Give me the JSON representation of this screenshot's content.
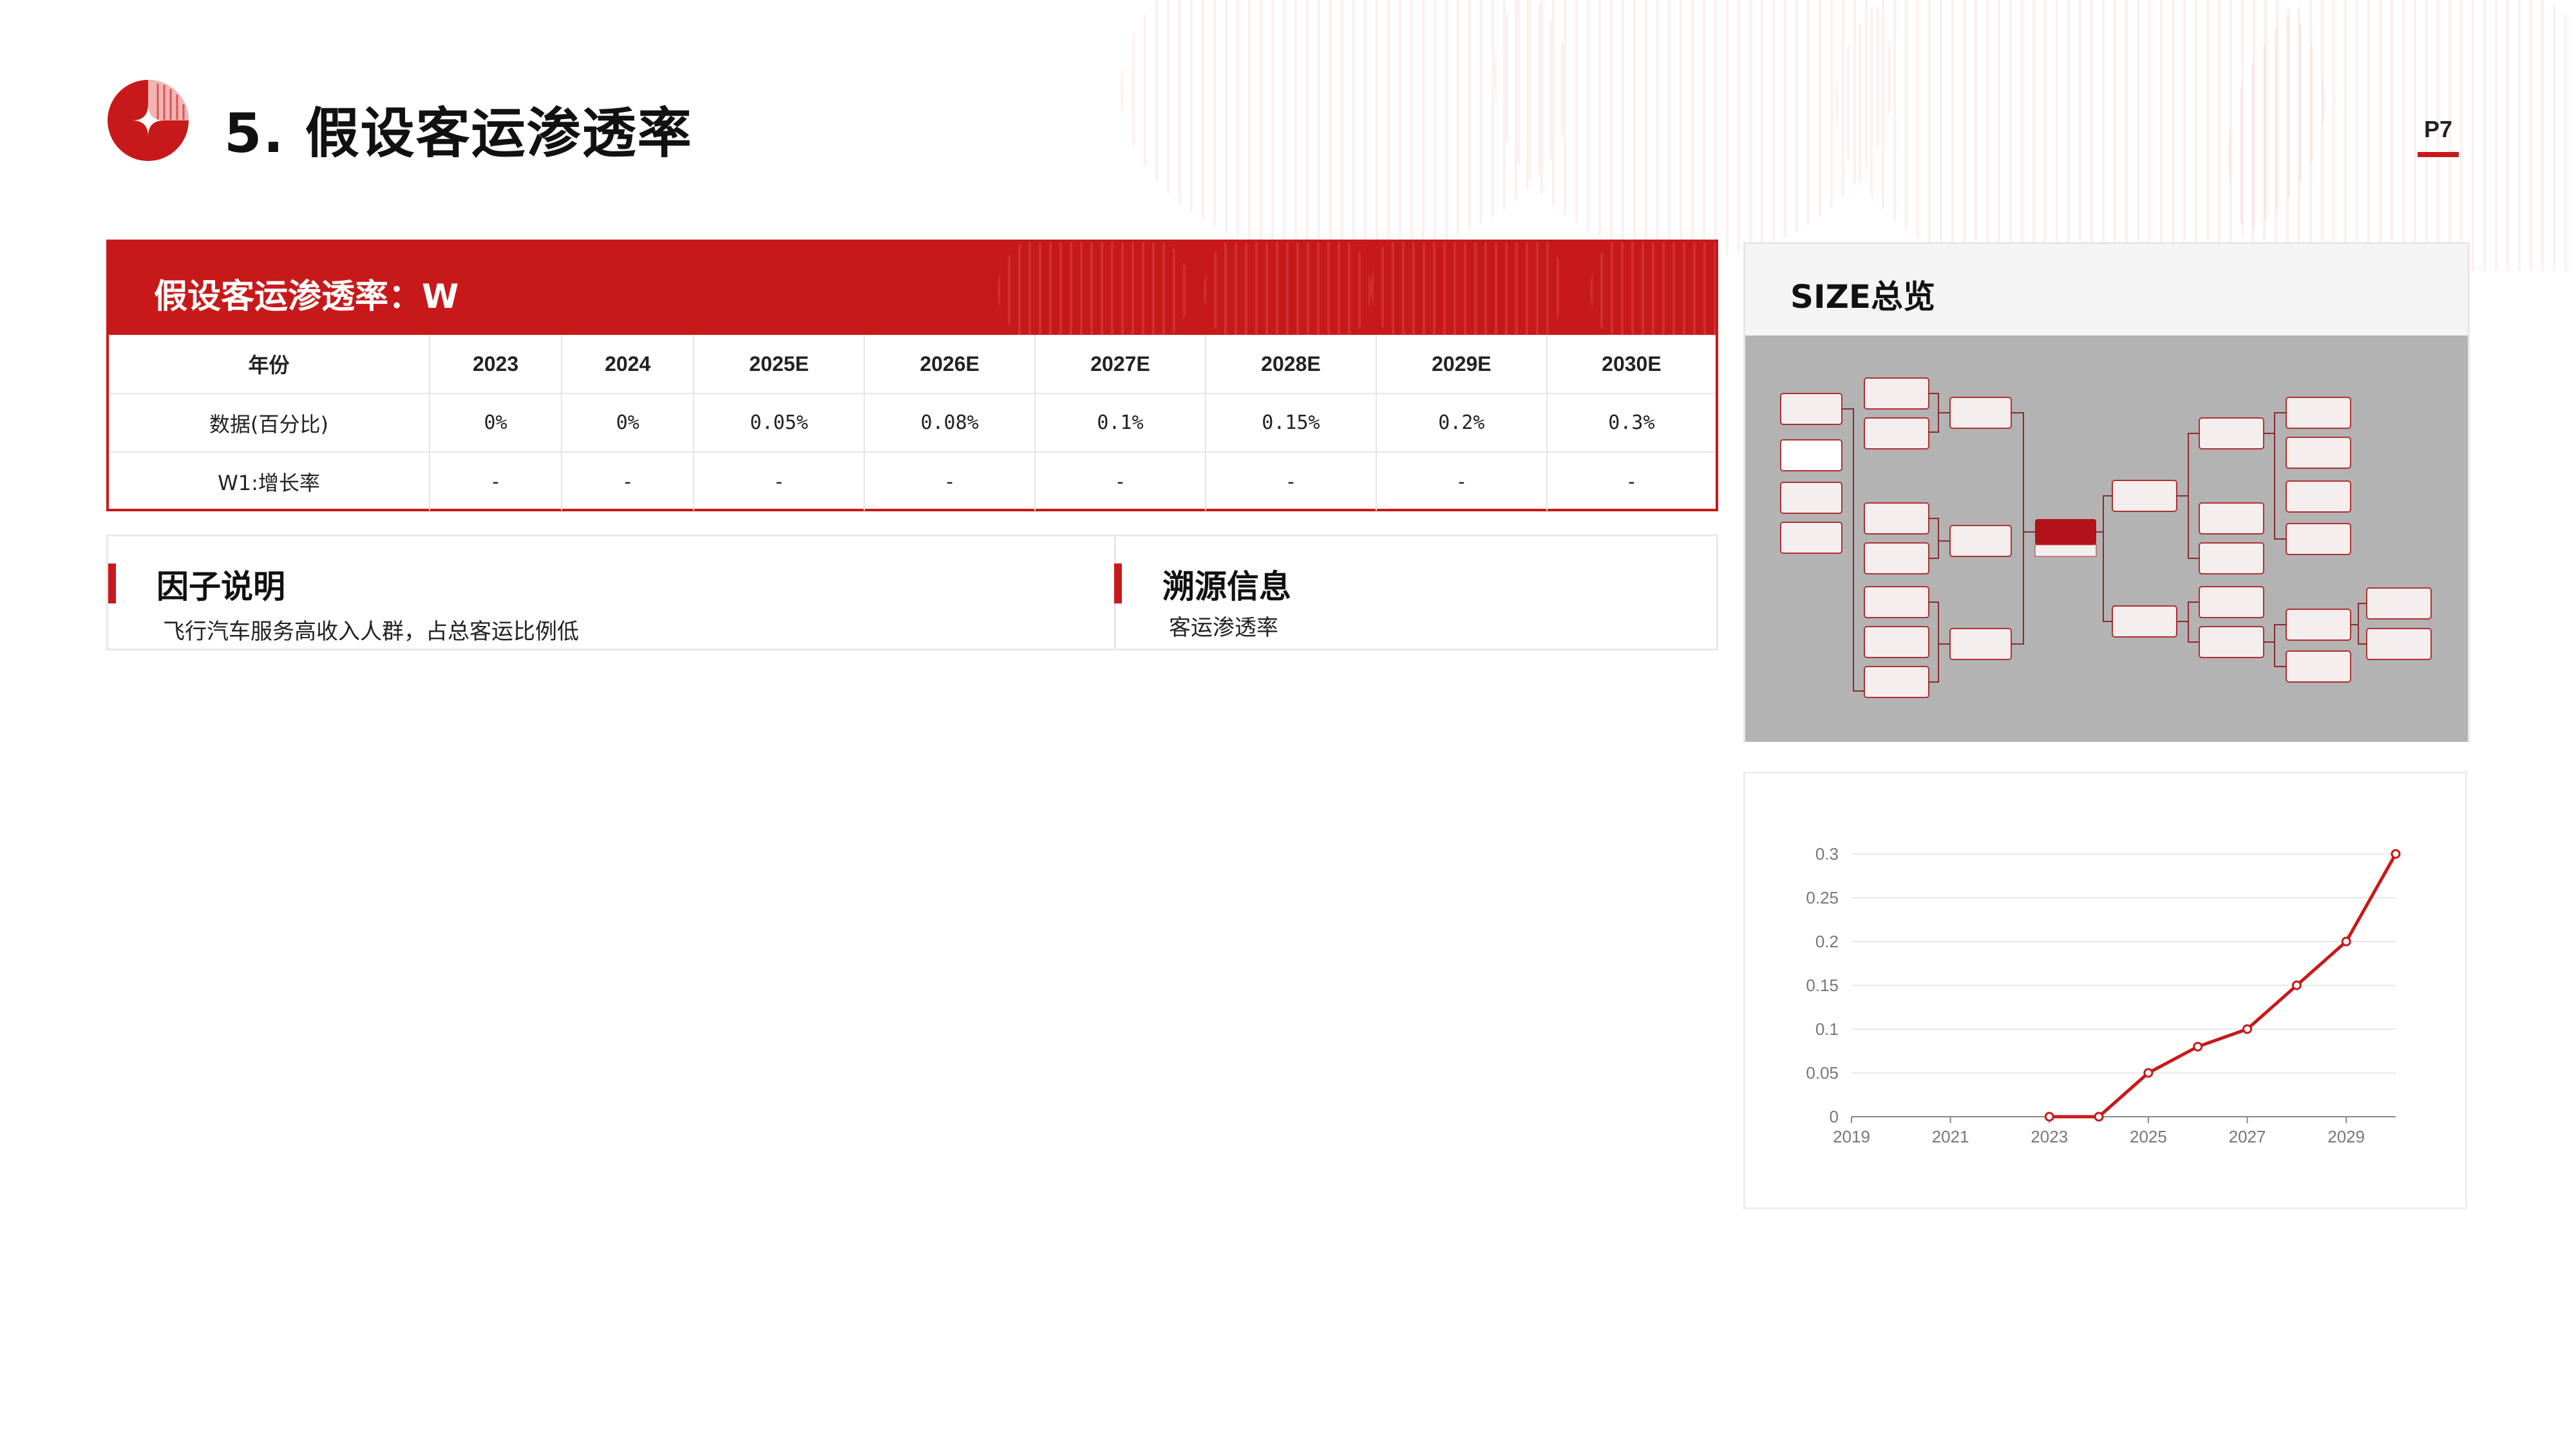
{
  "header": {
    "title": "5.  假设客运渗透率",
    "page_number": "P7"
  },
  "colors": {
    "accent": "#c8191a",
    "line": "#c8191a",
    "map_bg": "#b3b3b3"
  },
  "table": {
    "title": "假设客运渗透率：W",
    "columns": [
      "年份",
      "2023",
      "2024",
      "2025E",
      "2026E",
      "2027E",
      "2028E",
      "2029E",
      "2030E"
    ],
    "rows": [
      [
        "数据(百分比)",
        "0%",
        "0%",
        "0.05%",
        "0.08%",
        "0.1%",
        "0.15%",
        "0.2%",
        "0.3%"
      ],
      [
        "W1:增长率",
        "-",
        "-",
        "-",
        "-",
        "-",
        "-",
        "-",
        "-"
      ]
    ]
  },
  "factor": {
    "title": "因子说明",
    "text": "飞行汽车服务高收入人群，占总客运比例低"
  },
  "source": {
    "title": "溯源信息",
    "text": "客运渗透率"
  },
  "size_overview": {
    "title": "SIZE总览",
    "icon": "mind-map-thumbnail"
  },
  "chart_data": {
    "type": "line",
    "x": [
      2023,
      2024,
      2025,
      2026,
      2027,
      2028,
      2029,
      2030
    ],
    "values": [
      0,
      0,
      0.05,
      0.08,
      0.1,
      0.15,
      0.2,
      0.3
    ],
    "xlim": [
      2019,
      2030
    ],
    "ylim": [
      0,
      0.3
    ],
    "x_ticks": [
      "2019",
      "2021",
      "2023",
      "2025",
      "2027",
      "2029"
    ],
    "y_ticks": [
      "0",
      "0.05",
      "0.1",
      "0.15",
      "0.2",
      "0.25",
      "0.3"
    ],
    "title": "",
    "xlabel": "",
    "ylabel": "",
    "grid": true
  }
}
